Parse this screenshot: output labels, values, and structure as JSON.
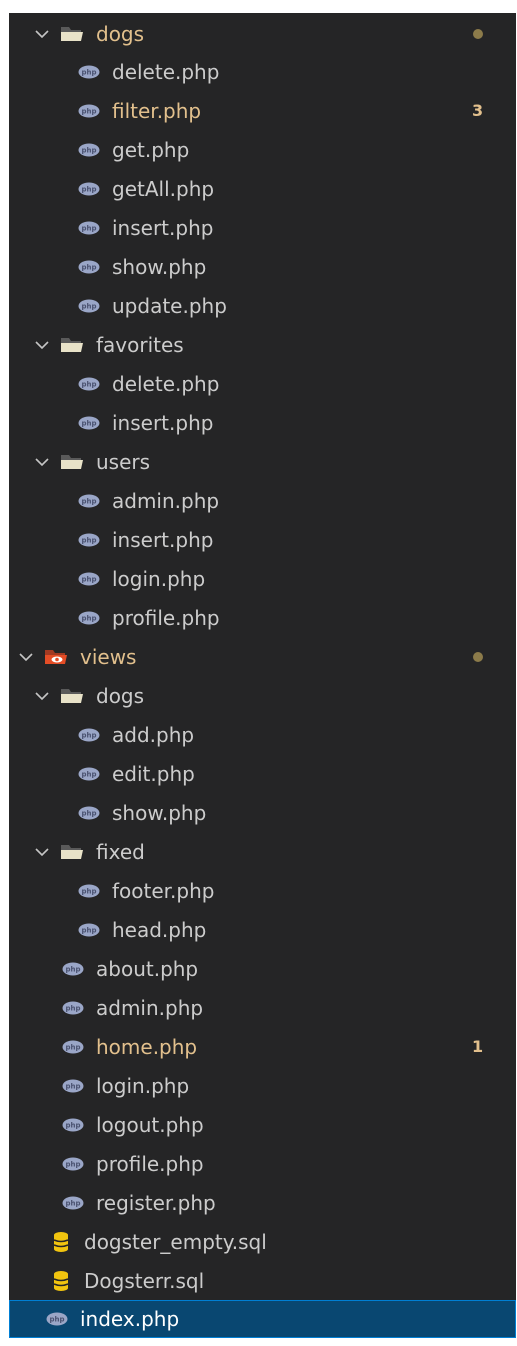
{
  "explorer": {
    "items": [
      {
        "label": "dogs",
        "type": "folder",
        "expanded": true,
        "modified": true,
        "marker": "dot"
      },
      {
        "label": "delete.php",
        "type": "php"
      },
      {
        "label": "filter.php",
        "type": "php",
        "modified": true,
        "badge": "3"
      },
      {
        "label": "get.php",
        "type": "php"
      },
      {
        "label": "getAll.php",
        "type": "php"
      },
      {
        "label": "insert.php",
        "type": "php"
      },
      {
        "label": "show.php",
        "type": "php"
      },
      {
        "label": "update.php",
        "type": "php"
      },
      {
        "label": "favorites",
        "type": "folder",
        "expanded": true
      },
      {
        "label": "delete.php",
        "type": "php"
      },
      {
        "label": "insert.php",
        "type": "php"
      },
      {
        "label": "users",
        "type": "folder",
        "expanded": true
      },
      {
        "label": "admin.php",
        "type": "php"
      },
      {
        "label": "insert.php",
        "type": "php"
      },
      {
        "label": "login.php",
        "type": "php"
      },
      {
        "label": "profile.php",
        "type": "php"
      },
      {
        "label": "views",
        "type": "views-folder",
        "expanded": true,
        "modified": true,
        "marker": "dot"
      },
      {
        "label": "dogs",
        "type": "folder",
        "expanded": true
      },
      {
        "label": "add.php",
        "type": "php"
      },
      {
        "label": "edit.php",
        "type": "php"
      },
      {
        "label": "show.php",
        "type": "php"
      },
      {
        "label": "fixed",
        "type": "folder",
        "expanded": true
      },
      {
        "label": "footer.php",
        "type": "php"
      },
      {
        "label": "head.php",
        "type": "php"
      },
      {
        "label": "about.php",
        "type": "php"
      },
      {
        "label": "admin.php",
        "type": "php"
      },
      {
        "label": "home.php",
        "type": "php",
        "modified": true,
        "badge": "1"
      },
      {
        "label": "login.php",
        "type": "php"
      },
      {
        "label": "logout.php",
        "type": "php"
      },
      {
        "label": "profile.php",
        "type": "php"
      },
      {
        "label": "register.php",
        "type": "php"
      },
      {
        "label": "dogster_empty.sql",
        "type": "sql"
      },
      {
        "label": "Dogsterr.sql",
        "type": "sql"
      },
      {
        "label": "index.php",
        "type": "php",
        "selected": true
      }
    ]
  },
  "colors": {
    "background": "#252526",
    "text": "#cccccc",
    "modified": "#e2c08d",
    "selection": "#094771",
    "php_icon": "#9aa6c7",
    "folder_icon": "#e8e2c8",
    "sql_icon": "#f1c40f",
    "views_icon": "#e44d26"
  }
}
